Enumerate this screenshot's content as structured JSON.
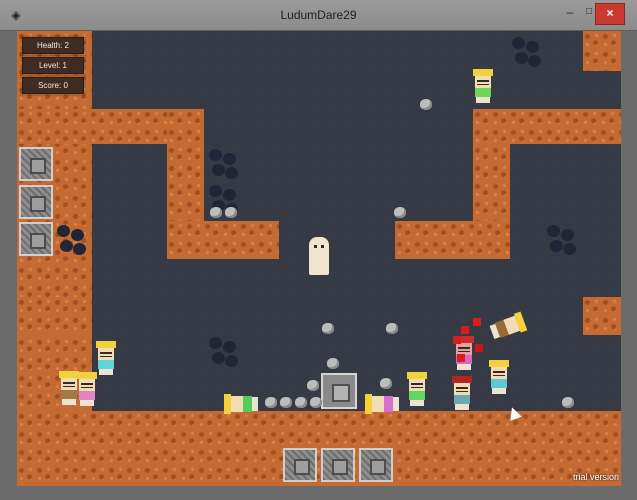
{
  "window": {
    "title": "LudumDare29",
    "controls": {
      "minimize": "–",
      "maximize": "□",
      "close": "×"
    }
  },
  "hud": {
    "health": "Health: 2",
    "level": "Level: 1",
    "score": "Score: 0"
  },
  "watermark": "trial version",
  "icons": {
    "app": "unity-icon",
    "cursor": "mouse-cursor-icon"
  }
}
